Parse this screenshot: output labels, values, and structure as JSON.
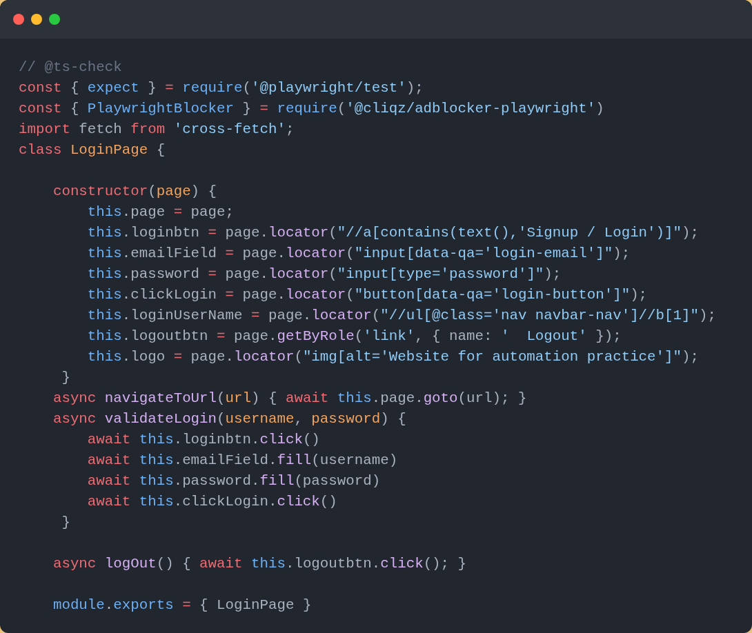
{
  "window": {
    "controls": [
      {
        "color": "#ff5f57"
      },
      {
        "color": "#febc2e"
      },
      {
        "color": "#28c840"
      }
    ]
  },
  "code": {
    "lines": [
      {
        "kind": "code",
        "tokens": [
          {
            "kind": "comment",
            "text": "// @ts-check"
          }
        ]
      },
      {
        "kind": "code",
        "tokens": [
          {
            "kind": "keyword",
            "text": "const"
          },
          {
            "kind": "plain",
            "text": " { "
          },
          {
            "kind": "variable",
            "text": "expect"
          },
          {
            "kind": "plain",
            "text": " } "
          },
          {
            "kind": "keyword",
            "text": "="
          },
          {
            "kind": "variable",
            "text": " require"
          },
          {
            "kind": "plain",
            "text": "("
          },
          {
            "kind": "string",
            "text": "'@playwright/test'"
          },
          {
            "kind": "plain",
            "text": ");"
          }
        ]
      },
      {
        "kind": "code",
        "tokens": [
          {
            "kind": "keyword",
            "text": "const"
          },
          {
            "kind": "plain",
            "text": " { "
          },
          {
            "kind": "variable",
            "text": "PlaywrightBlocker"
          },
          {
            "kind": "plain",
            "text": " } "
          },
          {
            "kind": "keyword",
            "text": "="
          },
          {
            "kind": "variable",
            "text": " require"
          },
          {
            "kind": "plain",
            "text": "("
          },
          {
            "kind": "string",
            "text": "'@cliqz/adblocker-playwright'"
          },
          {
            "kind": "plain",
            "text": ")"
          }
        ]
      },
      {
        "kind": "code",
        "tokens": [
          {
            "kind": "keyword",
            "text": "import"
          },
          {
            "kind": "plain",
            "text": " fetch "
          },
          {
            "kind": "keyword",
            "text": "from"
          },
          {
            "kind": "string",
            "text": " 'cross-fetch'"
          },
          {
            "kind": "plain",
            "text": ";"
          }
        ]
      },
      {
        "kind": "code",
        "tokens": [
          {
            "kind": "keyword",
            "text": "class"
          },
          {
            "kind": "type",
            "text": " LoginPage"
          },
          {
            "kind": "plain",
            "text": " {"
          }
        ]
      },
      {
        "kind": "blank"
      },
      {
        "kind": "code",
        "tokens": [
          {
            "kind": "keyword",
            "text": "    constructor"
          },
          {
            "kind": "plain",
            "text": "("
          },
          {
            "kind": "type",
            "text": "page"
          },
          {
            "kind": "plain",
            "text": ") {"
          }
        ]
      },
      {
        "kind": "code",
        "tokens": [
          {
            "kind": "variable",
            "text": "        this"
          },
          {
            "kind": "plain",
            "text": ".page "
          },
          {
            "kind": "keyword",
            "text": "="
          },
          {
            "kind": "plain",
            "text": " page;"
          }
        ]
      },
      {
        "kind": "code",
        "tokens": [
          {
            "kind": "variable",
            "text": "        this"
          },
          {
            "kind": "plain",
            "text": ".loginbtn "
          },
          {
            "kind": "keyword",
            "text": "="
          },
          {
            "kind": "plain",
            "text": " page."
          },
          {
            "kind": "function",
            "text": "locator"
          },
          {
            "kind": "plain",
            "text": "("
          },
          {
            "kind": "string",
            "text": "\"//a[contains(text(),'Signup / Login')]\""
          },
          {
            "kind": "plain",
            "text": ");"
          }
        ]
      },
      {
        "kind": "code",
        "tokens": [
          {
            "kind": "variable",
            "text": "        this"
          },
          {
            "kind": "plain",
            "text": ".emailField "
          },
          {
            "kind": "keyword",
            "text": "="
          },
          {
            "kind": "plain",
            "text": " page."
          },
          {
            "kind": "function",
            "text": "locator"
          },
          {
            "kind": "plain",
            "text": "("
          },
          {
            "kind": "string",
            "text": "\"input[data-qa='login-email']\""
          },
          {
            "kind": "plain",
            "text": ");"
          }
        ]
      },
      {
        "kind": "code",
        "tokens": [
          {
            "kind": "variable",
            "text": "        this"
          },
          {
            "kind": "plain",
            "text": ".password "
          },
          {
            "kind": "keyword",
            "text": "="
          },
          {
            "kind": "plain",
            "text": " page."
          },
          {
            "kind": "function",
            "text": "locator"
          },
          {
            "kind": "plain",
            "text": "("
          },
          {
            "kind": "string",
            "text": "\"input[type='password']\""
          },
          {
            "kind": "plain",
            "text": ");"
          }
        ]
      },
      {
        "kind": "code",
        "tokens": [
          {
            "kind": "variable",
            "text": "        this"
          },
          {
            "kind": "plain",
            "text": ".clickLogin "
          },
          {
            "kind": "keyword",
            "text": "="
          },
          {
            "kind": "plain",
            "text": " page."
          },
          {
            "kind": "function",
            "text": "locator"
          },
          {
            "kind": "plain",
            "text": "("
          },
          {
            "kind": "string",
            "text": "\"button[data-qa='login-button']\""
          },
          {
            "kind": "plain",
            "text": ");"
          }
        ]
      },
      {
        "kind": "code",
        "tokens": [
          {
            "kind": "variable",
            "text": "        this"
          },
          {
            "kind": "plain",
            "text": ".loginUserName "
          },
          {
            "kind": "keyword",
            "text": "="
          },
          {
            "kind": "plain",
            "text": " page."
          },
          {
            "kind": "function",
            "text": "locator"
          },
          {
            "kind": "plain",
            "text": "("
          },
          {
            "kind": "string",
            "text": "\"//ul[@class='nav navbar-nav']//b[1]\""
          },
          {
            "kind": "plain",
            "text": ");"
          }
        ]
      },
      {
        "kind": "code",
        "tokens": [
          {
            "kind": "variable",
            "text": "        this"
          },
          {
            "kind": "plain",
            "text": ".logoutbtn "
          },
          {
            "kind": "keyword",
            "text": "="
          },
          {
            "kind": "plain",
            "text": " page."
          },
          {
            "kind": "function",
            "text": "getByRole"
          },
          {
            "kind": "plain",
            "text": "("
          },
          {
            "kind": "string",
            "text": "'link'"
          },
          {
            "kind": "plain",
            "text": ", { name: "
          },
          {
            "kind": "string",
            "text": "'  Logout'"
          },
          {
            "kind": "plain",
            "text": " });"
          }
        ]
      },
      {
        "kind": "code",
        "tokens": [
          {
            "kind": "variable",
            "text": "        this"
          },
          {
            "kind": "plain",
            "text": ".logo "
          },
          {
            "kind": "keyword",
            "text": "="
          },
          {
            "kind": "plain",
            "text": " page."
          },
          {
            "kind": "function",
            "text": "locator"
          },
          {
            "kind": "plain",
            "text": "("
          },
          {
            "kind": "string",
            "text": "\"img[alt='Website for automation practice']\""
          },
          {
            "kind": "plain",
            "text": ");"
          }
        ]
      },
      {
        "kind": "code",
        "tokens": [
          {
            "kind": "plain",
            "text": "     }"
          }
        ]
      },
      {
        "kind": "code",
        "tokens": [
          {
            "kind": "keyword",
            "text": "    async"
          },
          {
            "kind": "function",
            "text": " navigateToUrl"
          },
          {
            "kind": "plain",
            "text": "("
          },
          {
            "kind": "type",
            "text": "url"
          },
          {
            "kind": "plain",
            "text": ") { "
          },
          {
            "kind": "keyword",
            "text": "await"
          },
          {
            "kind": "variable",
            "text": " this"
          },
          {
            "kind": "plain",
            "text": ".page."
          },
          {
            "kind": "function",
            "text": "goto"
          },
          {
            "kind": "plain",
            "text": "(url); }"
          }
        ]
      },
      {
        "kind": "code",
        "tokens": [
          {
            "kind": "keyword",
            "text": "    async"
          },
          {
            "kind": "function",
            "text": " validateLogin"
          },
          {
            "kind": "plain",
            "text": "("
          },
          {
            "kind": "type",
            "text": "username"
          },
          {
            "kind": "plain",
            "text": ", "
          },
          {
            "kind": "type",
            "text": "password"
          },
          {
            "kind": "plain",
            "text": ") {"
          }
        ]
      },
      {
        "kind": "code",
        "tokens": [
          {
            "kind": "keyword",
            "text": "        await"
          },
          {
            "kind": "variable",
            "text": " this"
          },
          {
            "kind": "plain",
            "text": ".loginbtn."
          },
          {
            "kind": "function",
            "text": "click"
          },
          {
            "kind": "plain",
            "text": "()"
          }
        ]
      },
      {
        "kind": "code",
        "tokens": [
          {
            "kind": "keyword",
            "text": "        await"
          },
          {
            "kind": "variable",
            "text": " this"
          },
          {
            "kind": "plain",
            "text": ".emailField."
          },
          {
            "kind": "function",
            "text": "fill"
          },
          {
            "kind": "plain",
            "text": "(username)"
          }
        ]
      },
      {
        "kind": "code",
        "tokens": [
          {
            "kind": "keyword",
            "text": "        await"
          },
          {
            "kind": "variable",
            "text": " this"
          },
          {
            "kind": "plain",
            "text": ".password."
          },
          {
            "kind": "function",
            "text": "fill"
          },
          {
            "kind": "plain",
            "text": "(password)"
          }
        ]
      },
      {
        "kind": "code",
        "tokens": [
          {
            "kind": "keyword",
            "text": "        await"
          },
          {
            "kind": "variable",
            "text": " this"
          },
          {
            "kind": "plain",
            "text": ".clickLogin."
          },
          {
            "kind": "function",
            "text": "click"
          },
          {
            "kind": "plain",
            "text": "()"
          }
        ]
      },
      {
        "kind": "code",
        "tokens": [
          {
            "kind": "plain",
            "text": "     }"
          }
        ]
      },
      {
        "kind": "blank"
      },
      {
        "kind": "code",
        "tokens": [
          {
            "kind": "keyword",
            "text": "    async"
          },
          {
            "kind": "function",
            "text": " logOut"
          },
          {
            "kind": "plain",
            "text": "() { "
          },
          {
            "kind": "keyword",
            "text": "await"
          },
          {
            "kind": "variable",
            "text": " this"
          },
          {
            "kind": "plain",
            "text": ".logoutbtn."
          },
          {
            "kind": "function",
            "text": "click"
          },
          {
            "kind": "plain",
            "text": "(); }"
          }
        ]
      },
      {
        "kind": "blank"
      },
      {
        "kind": "code",
        "tokens": [
          {
            "kind": "variable",
            "text": "    module"
          },
          {
            "kind": "plain",
            "text": "."
          },
          {
            "kind": "variable",
            "text": "exports"
          },
          {
            "kind": "keyword",
            "text": " ="
          },
          {
            "kind": "plain",
            "text": " { LoginPage }"
          }
        ]
      }
    ]
  }
}
